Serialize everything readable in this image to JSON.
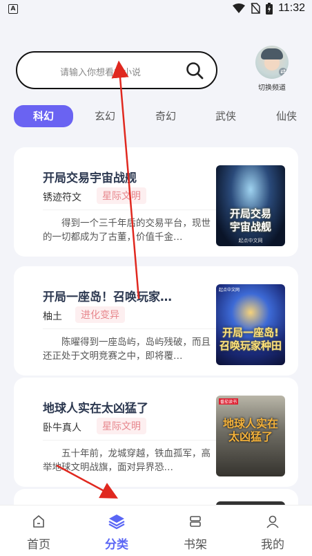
{
  "status_bar": {
    "time": "11:32",
    "left_icon": "A"
  },
  "search": {
    "placeholder": "请输入你想看的小说"
  },
  "channel": {
    "label": "切换频道"
  },
  "tabs": [
    {
      "label": "科幻",
      "active": true
    },
    {
      "label": "玄幻"
    },
    {
      "label": "奇幻"
    },
    {
      "label": "武侠"
    },
    {
      "label": "仙侠"
    }
  ],
  "books": [
    {
      "title": "开局交易宇宙战舰",
      "author": "锈迹符文",
      "tag": "星际文明",
      "desc": "得到一个三千年后的交易平台，现世的一切都成为了古董，价值千金…",
      "cover_text_1": "开局交易",
      "cover_text_2": "宇宙战舰",
      "cover_publisher": "起点中文网"
    },
    {
      "title": "开局一座岛！召唤玩家…",
      "author": "柚土",
      "tag": "进化变异",
      "desc": "陈曜得到一座岛屿，岛屿残破，而且还正处于文明竞赛之中，即将覆…",
      "cover_text_1": "开局一座岛!",
      "cover_text_2": "召唤玩家种田",
      "cover_publisher": "起点中文网"
    },
    {
      "title": "地球人实在太凶猛了",
      "author": "卧牛真人",
      "tag": "星际文明",
      "desc": "五十年前，龙城穿越，铁血孤军，高举地球文明战旗，面对异界恐…",
      "cover_text_1": "地球人实在",
      "cover_text_2": "太凶猛了",
      "cover_publisher": "番茄读书"
    }
  ],
  "nav": [
    {
      "label": "首页"
    },
    {
      "label": "分类",
      "active": true
    },
    {
      "label": "书架"
    },
    {
      "label": "我的"
    }
  ],
  "colors": {
    "accent": "#6a63f2",
    "tag_bg": "#fdeff0",
    "tag_text": "#e7868c",
    "arrow": "#e0281f"
  }
}
